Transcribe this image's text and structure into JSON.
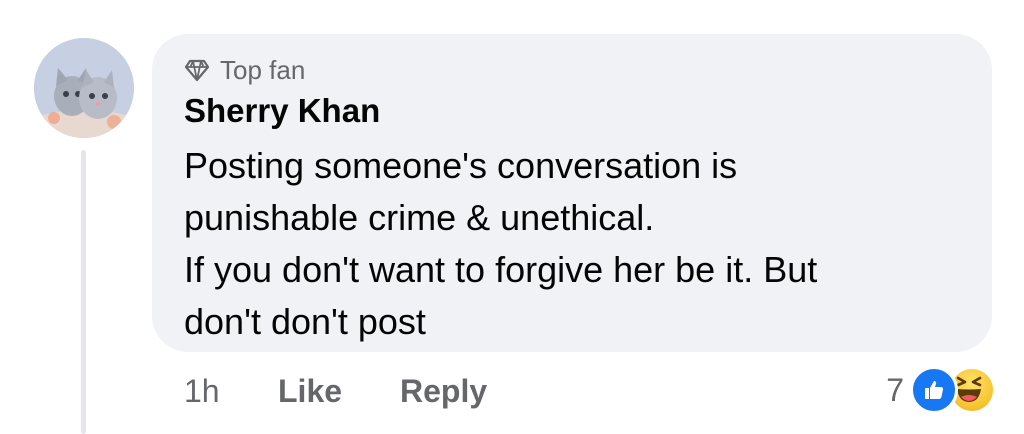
{
  "comment": {
    "badge": "Top fan",
    "author": "Sherry Khan",
    "text_lines": [
      "Posting someone's conversation is",
      "punishable crime & unethical.",
      "If you don't want to forgive her be it. But",
      "don't don't post"
    ],
    "time": "1h",
    "like_label": "Like",
    "reply_label": "Reply",
    "reaction_count": "7",
    "reaction_icons": [
      "like-icon",
      "haha-icon"
    ]
  },
  "colors": {
    "bubble_bg": "#f0f2f5",
    "meta_text": "#65676b",
    "like_blue": "#1877f2",
    "haha_yellow": "#f7c22d"
  }
}
